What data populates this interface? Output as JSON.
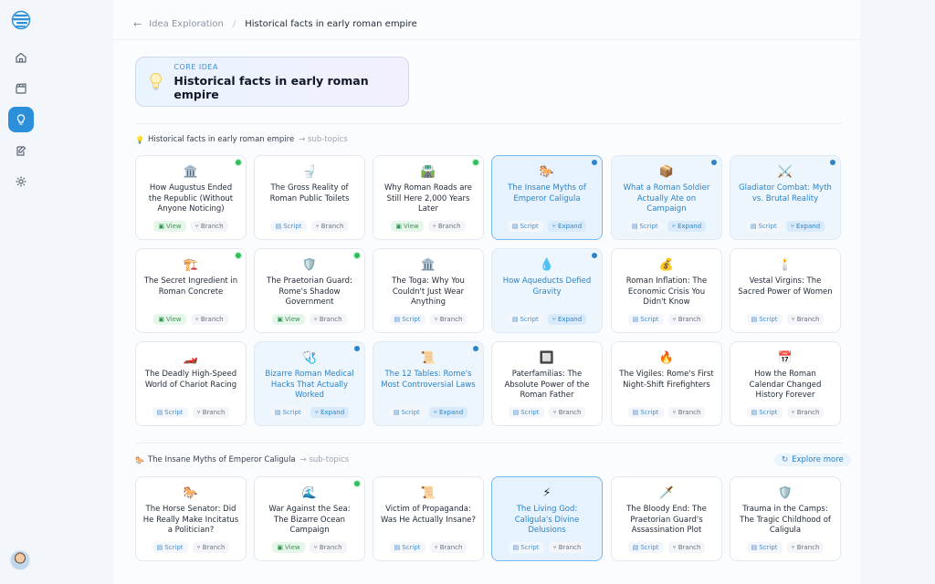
{
  "breadcrumb": {
    "parent": "Idea Exploration",
    "separator": "/",
    "current": "Historical facts in early roman empire"
  },
  "core_idea": {
    "label": "CORE IDEA",
    "title": "Historical facts in early roman empire",
    "icon": "lightbulb-icon"
  },
  "sections": [
    {
      "icon": "💡",
      "title": "Historical facts in early roman empire",
      "suffix": "→ sub-topics"
    },
    {
      "icon": "🐎",
      "title": "The Insane Myths of Emperor Caligula",
      "suffix": "→ sub-topics"
    }
  ],
  "explore_more": "Explore more",
  "labels": {
    "view": "View",
    "script": "Script",
    "branch": "Branch",
    "expand": "Expand"
  },
  "cards": [
    {
      "emoji": "🏛️",
      "title": "How Augustus Ended the Republic (Without Anyone Noticing)",
      "actions": [
        "view",
        "branch"
      ],
      "state": "plain",
      "dot": "green"
    },
    {
      "emoji": "🚽",
      "title": "The Gross Reality of Roman Public Toilets",
      "actions": [
        "script",
        "branch"
      ],
      "state": "plain",
      "dot": ""
    },
    {
      "emoji": "🛣️",
      "title": "Why Roman Roads are Still Here 2,000 Years Later",
      "actions": [
        "view",
        "branch"
      ],
      "state": "plain",
      "dot": "green"
    },
    {
      "emoji": "🐎",
      "title": "The Insane Myths of Emperor Caligula",
      "actions": [
        "script",
        "expand"
      ],
      "state": "sel",
      "dot": "blue"
    },
    {
      "emoji": "📦",
      "title": "What a Roman Soldier Actually Ate on Campaign",
      "actions": [
        "script",
        "expand"
      ],
      "state": "hl",
      "dot": "blue"
    },
    {
      "emoji": "⚔️",
      "title": "Gladiator Combat: Myth vs. Brutal Reality",
      "actions": [
        "script",
        "expand"
      ],
      "state": "hl",
      "dot": "blue"
    },
    {
      "emoji": "🏗️",
      "title": "The Secret Ingredient in Roman Concrete",
      "actions": [
        "view",
        "branch"
      ],
      "state": "plain",
      "dot": "green"
    },
    {
      "emoji": "🛡️",
      "title": "The Praetorian Guard: Rome's Shadow Government",
      "actions": [
        "view",
        "branch"
      ],
      "state": "plain",
      "dot": "green"
    },
    {
      "emoji": "🏛️",
      "title": "The Toga: Why You Couldn't Just Wear Anything",
      "actions": [
        "script",
        "branch"
      ],
      "state": "plain",
      "dot": ""
    },
    {
      "emoji": "💧",
      "title": "How Aqueducts Defied Gravity",
      "actions": [
        "script",
        "expand"
      ],
      "state": "hl",
      "dot": "blue"
    },
    {
      "emoji": "💰",
      "title": "Roman Inflation: The Economic Crisis You Didn't Know",
      "actions": [
        "script",
        "branch"
      ],
      "state": "plain",
      "dot": ""
    },
    {
      "emoji": "🕯️",
      "title": "Vestal Virgins: The Sacred Power of Women",
      "actions": [
        "script",
        "branch"
      ],
      "state": "plain",
      "dot": ""
    },
    {
      "emoji": "🏎️",
      "title": "The Deadly High-Speed World of Chariot Racing",
      "actions": [
        "script",
        "branch"
      ],
      "state": "plain",
      "dot": ""
    },
    {
      "emoji": "🩺",
      "title": "Bizarre Roman Medical Hacks That Actually Worked",
      "actions": [
        "script",
        "expand"
      ],
      "state": "hl",
      "dot": "blue"
    },
    {
      "emoji": "📜",
      "title": "The 12 Tables: Rome's Most Controversial Laws",
      "actions": [
        "script",
        "expand"
      ],
      "state": "hl",
      "dot": "blue"
    },
    {
      "emoji": "🔲",
      "title": "Paterfamilias: The Absolute Power of the Roman Father",
      "actions": [
        "script",
        "branch"
      ],
      "state": "plain",
      "dot": ""
    },
    {
      "emoji": "🔥",
      "title": "The Vigiles: Rome's First Night-Shift Firefighters",
      "actions": [
        "script",
        "branch"
      ],
      "state": "plain",
      "dot": ""
    },
    {
      "emoji": "📅",
      "title": "How the Roman Calendar Changed History Forever",
      "actions": [
        "script",
        "branch"
      ],
      "state": "plain",
      "dot": ""
    },
    {
      "emoji": "🐎",
      "title": "The Horse Senator: Did He Really Make Incitatus a Politician?",
      "actions": [
        "script",
        "branch"
      ],
      "state": "plain",
      "dot": ""
    },
    {
      "emoji": "🌊",
      "title": "War Against the Sea: The Bizarre Ocean Campaign",
      "actions": [
        "view",
        "branch"
      ],
      "state": "plain",
      "dot": "green"
    },
    {
      "emoji": "📜",
      "title": "Victim of Propaganda: Was He Actually Insane?",
      "actions": [
        "script",
        "branch"
      ],
      "state": "plain",
      "dot": ""
    },
    {
      "emoji": "⚡",
      "title": "The Living God: Caligula's Divine Delusions",
      "actions": [
        "script",
        "branch"
      ],
      "state": "sel",
      "dot": ""
    },
    {
      "emoji": "🗡️",
      "title": "The Bloody End: The Praetorian Guard's Assassination Plot",
      "actions": [
        "script",
        "branch"
      ],
      "state": "plain",
      "dot": ""
    },
    {
      "emoji": "🛡️",
      "title": "Trauma in the Camps: The Tragic Childhood of Caligula",
      "actions": [
        "script",
        "branch"
      ],
      "state": "plain",
      "dot": ""
    }
  ]
}
